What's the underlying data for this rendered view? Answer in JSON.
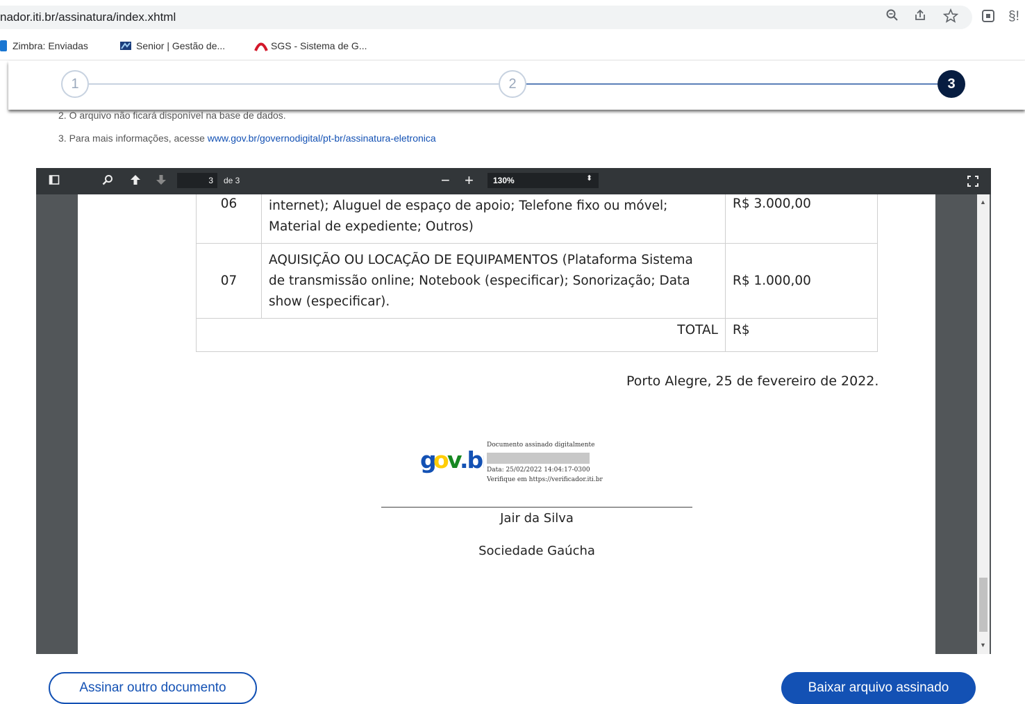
{
  "browser": {
    "url": "nador.iti.br/assinatura/index.xhtml",
    "icons": [
      "zoom-icon",
      "share-icon",
      "star-icon",
      "extension-icon",
      "profile-icon"
    ],
    "ext_label": "§!"
  },
  "bookmarks": [
    {
      "label": "Zimbra: Enviadas",
      "icon": "zimbra-icon"
    },
    {
      "label": "Senior | Gestão de...",
      "icon": "senior-icon"
    },
    {
      "label": "SGS - Sistema de G...",
      "icon": "sgs-icon"
    }
  ],
  "stepper": {
    "steps": [
      "1",
      "2",
      "3"
    ],
    "current": 3
  },
  "info": {
    "line2": "2. O arquivo não ficará disponível na base de dados.",
    "line3_prefix": "3. Para mais informações, acesse ",
    "line3_link": "www.gov.br/governodigital/pt-br/assinatura-eletronica"
  },
  "pdf_viewer": {
    "page_current": "3",
    "page_total_label": "de 3",
    "zoom": "130%",
    "minus": "−",
    "plus": "+"
  },
  "document": {
    "rows": [
      {
        "num": "06",
        "desc_lines": [
          "internet); Aluguel de espaço de apoio; Telefone fixo ou móvel;",
          "Material de expediente; Outros)"
        ],
        "value": "R$ 3.000,00"
      },
      {
        "num": "07",
        "desc_lines": [
          "AQUISIÇÃO OU LOCAÇÃO DE EQUIPAMENTOS (Plataforma Sistema",
          "de transmissão online; Notebook (especificar); Sonorização; Data",
          "show (especificar)."
        ],
        "value": "R$ 1.000,00"
      }
    ],
    "total_label": "TOTAL",
    "total_value": "R$",
    "place_date": "Porto Alegre, 25 de fevereiro de 2022.",
    "signature": {
      "logo": "gov.br",
      "line1": "Documento assinado digitalmente",
      "line2": "Data: 25/02/2022 14:04:17-0300",
      "line3": "Verifique em https://verificador.iti.br"
    },
    "signer_name": "Jair da Silva",
    "signer_org": "Sociedade Gaúcha"
  },
  "actions": {
    "secondary": "Assinar outro documento",
    "primary": "Baixar arquivo assinado"
  },
  "colors": {
    "primary": "#1351b4",
    "step_done": "#071d41",
    "pdf_toolbar": "#323639",
    "pdf_bg": "#525659",
    "gov_blue": "#1351b4",
    "gov_yellow": "#ffcd07",
    "gov_green": "#168821"
  }
}
